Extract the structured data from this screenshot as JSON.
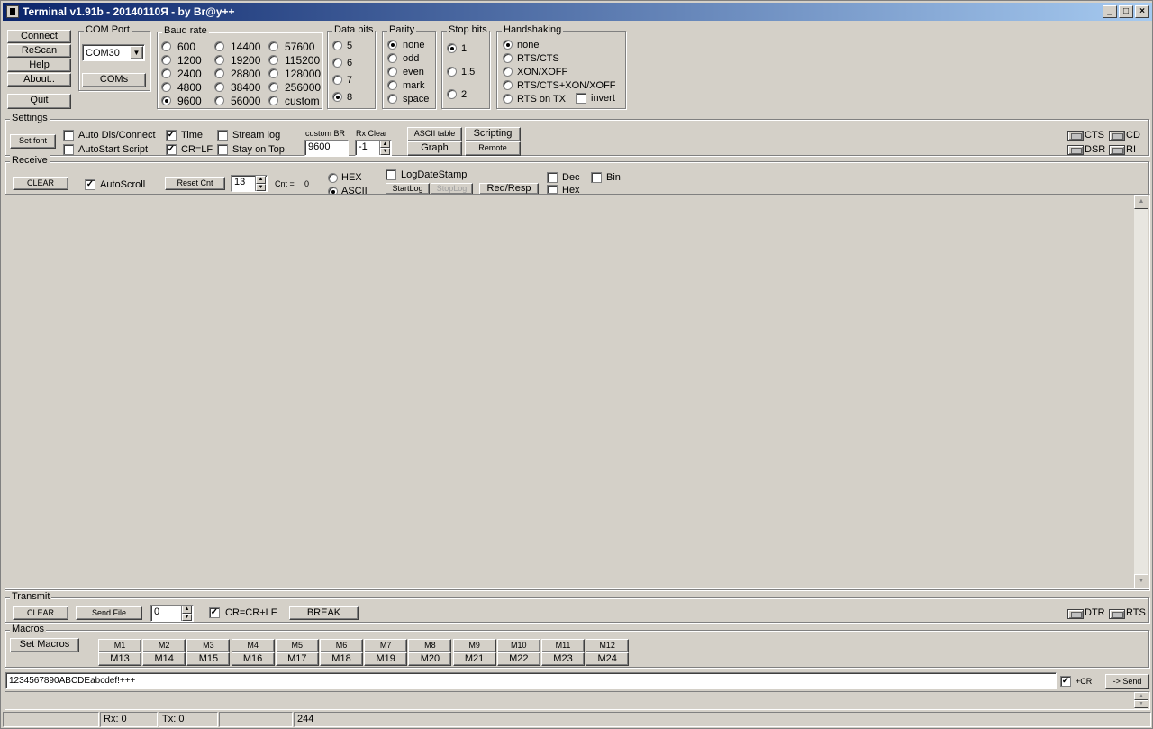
{
  "window": {
    "title": "Terminal v1.91b - 20140110Я - by Br@y++",
    "min": "_",
    "max": "□",
    "close": "×"
  },
  "top_buttons": {
    "connect": "Connect",
    "rescan": "ReScan",
    "help": "Help",
    "about": "About..",
    "quit": "Quit"
  },
  "com_port": {
    "label": "COM Port",
    "value": "COM30",
    "coms_btn": "COMs"
  },
  "baud_rate": {
    "label": "Baud rate",
    "options": [
      "600",
      "1200",
      "2400",
      "4800",
      "9600",
      "14400",
      "19200",
      "28800",
      "38400",
      "56000",
      "57600",
      "115200",
      "128000",
      "256000",
      "custom"
    ],
    "selected": "9600"
  },
  "data_bits": {
    "label": "Data bits",
    "options": [
      "5",
      "6",
      "7",
      "8"
    ],
    "selected": "8"
  },
  "parity": {
    "label": "Parity",
    "options": [
      "none",
      "odd",
      "even",
      "mark",
      "space"
    ],
    "selected": "none"
  },
  "stop_bits": {
    "label": "Stop bits",
    "options": [
      "1",
      "1.5",
      "2"
    ],
    "selected": "1"
  },
  "handshaking": {
    "label": "Handshaking",
    "options": [
      "none",
      "RTS/CTS",
      "XON/XOFF",
      "RTS/CTS+XON/XOFF",
      "RTS on TX"
    ],
    "selected": "none",
    "invert_label": "invert"
  },
  "settings": {
    "label": "Settings",
    "set_font": "Set font",
    "auto_dis_connect": "Auto Dis/Connect",
    "autostart_script": "AutoStart Script",
    "time": "Time",
    "cr_lf": "CR=LF",
    "stream_log": "Stream log",
    "stay_on_top": "Stay on Top",
    "custom_br_label": "custom BR",
    "custom_br_value": "9600",
    "rx_clear_label": "Rx Clear",
    "rx_clear_value": "-1",
    "ascii_table": "ASCII table",
    "graph": "Graph",
    "scripting": "Scripting",
    "remote": "Remote",
    "cts": "CTS",
    "cd": "CD",
    "dsr": "DSR",
    "ri": "RI",
    "check_mark": "✓"
  },
  "receive": {
    "label": "Receive",
    "clear": "CLEAR",
    "autoscroll": "AutoScroll",
    "reset_cnt": "Reset Cnt",
    "cnt_spin": "13",
    "cnt_label": "Cnt =",
    "cnt_value": "0",
    "hex": "HEX",
    "ascii": "ASCII",
    "log_date_stamp": "LogDateStamp",
    "start_log": "StartLog",
    "stop_log": "StopLog",
    "req_resp": "Req/Resp",
    "dec": "Dec",
    "bin": "Bin",
    "hex_chk": "Hex"
  },
  "transmit": {
    "label": "Transmit",
    "clear": "CLEAR",
    "send_file": "Send File",
    "spin": "0",
    "cr_crlf": "CR=CR+LF",
    "break": "BREAK",
    "dtr": "DTR",
    "rts": "RTS"
  },
  "macros": {
    "label": "Macros",
    "set_macros": "Set Macros",
    "row1": [
      "M1",
      "M2",
      "M3",
      "M4",
      "M5",
      "M6",
      "M7",
      "M8",
      "M9",
      "M10",
      "M11",
      "M12"
    ],
    "row2": [
      "M13",
      "M14",
      "M15",
      "M16",
      "M17",
      "M18",
      "M19",
      "M20",
      "M21",
      "M22",
      "M23",
      "M24"
    ]
  },
  "send_line": {
    "value": "1234567890ABCDEabcdef!+++",
    "plus_cr": "+CR",
    "send": "-> Send"
  },
  "status_bar": {
    "rx": "Rx: 0",
    "tx": "Tx: 0",
    "count": "244"
  }
}
